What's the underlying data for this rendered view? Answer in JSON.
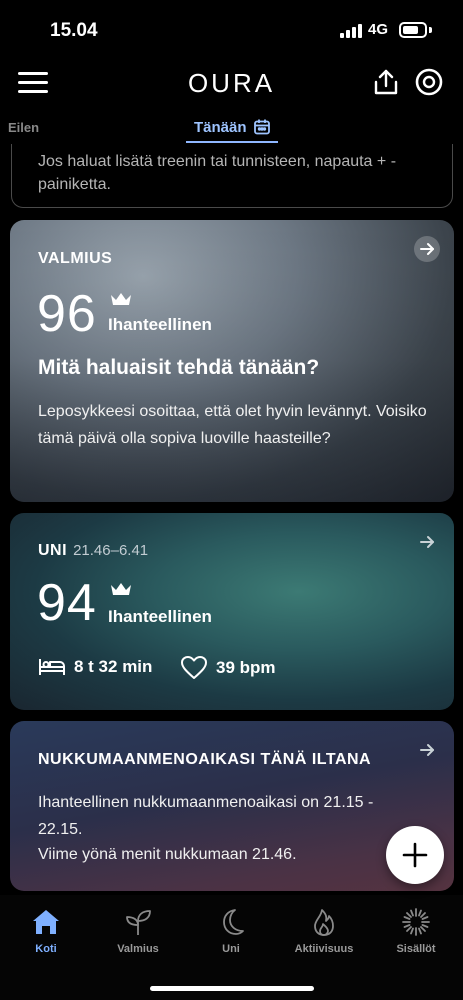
{
  "status_bar": {
    "time": "15.04",
    "network": "4G"
  },
  "header": {
    "brand": "OURA"
  },
  "tabs": {
    "previous": "Eilen",
    "current": "Tänään"
  },
  "note": {
    "text": "Jos haluat lisätä treenin tai tunnisteen, napauta + -painiketta."
  },
  "readiness_card": {
    "title": "VALMIUS",
    "score": "96",
    "score_label": "Ihanteellinen",
    "headline": "Mitä haluaisit tehdä tänään?",
    "body": "Leposykkeesi osoittaa, että olet hyvin levännyt. Voisiko tämä päivä olla sopiva luoville haasteille?"
  },
  "sleep_card": {
    "title": "UNI",
    "time_range": "21.46–6.41",
    "score": "94",
    "score_label": "Ihanteellinen",
    "duration": "8 t 32 min",
    "heart_rate": "39 bpm"
  },
  "bedtime_card": {
    "title": "NUKKUMAANMENOAIKASI TÄNÄ ILTANA",
    "line1": "Ihanteellinen nukkumaanmenoaikasi on 21.15 - 22.15.",
    "line2": "Viime yönä menit nukkumaan 21.46."
  },
  "bottom_nav": {
    "items": [
      {
        "label": "Koti",
        "icon": "home-icon",
        "active": true
      },
      {
        "label": "Valmius",
        "icon": "sprout-icon",
        "active": false
      },
      {
        "label": "Uni",
        "icon": "moon-icon",
        "active": false
      },
      {
        "label": "Aktiivisuus",
        "icon": "flame-icon",
        "active": false
      },
      {
        "label": "Sisällöt",
        "icon": "sparkle-icon",
        "active": false
      }
    ]
  },
  "colors": {
    "accent": "#7fb0ff",
    "background": "#000000"
  }
}
